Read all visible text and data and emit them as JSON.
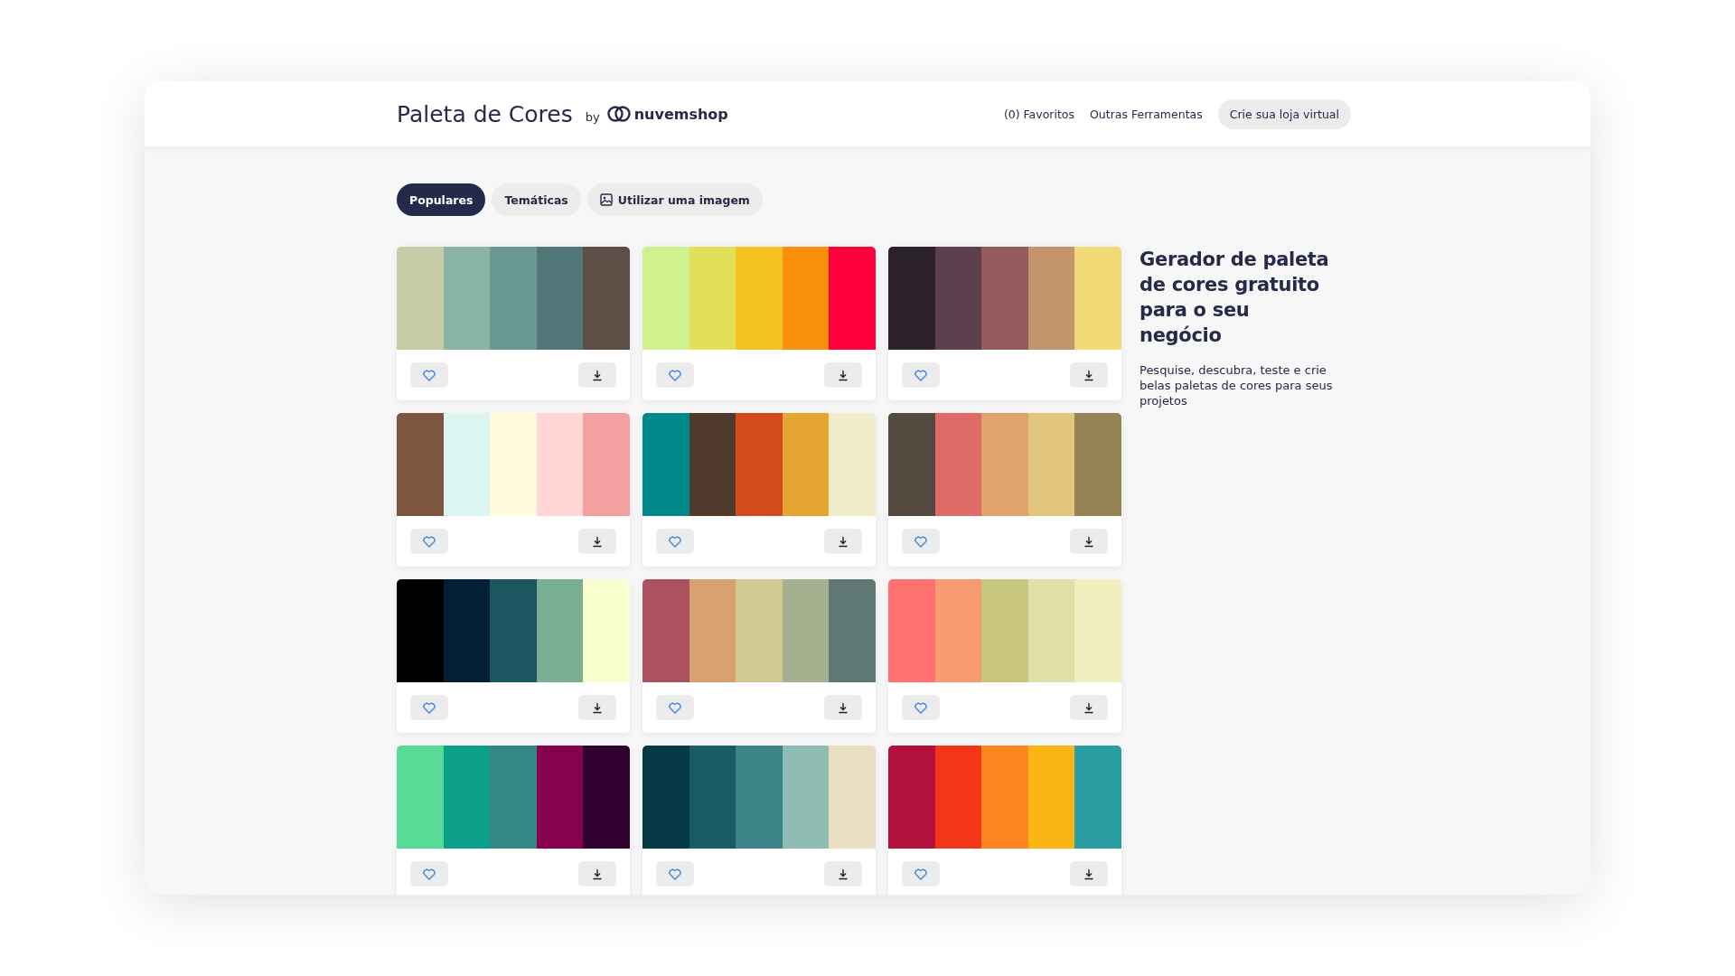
{
  "header": {
    "title": "Paleta de Cores",
    "by": "by",
    "brand": "nuvemshop",
    "nav": [
      "(0) Favoritos",
      "Outras Ferramentas"
    ],
    "cta": "Crie sua loja virtual"
  },
  "tabs": [
    {
      "label": "Populares",
      "selected": true,
      "kind": "text"
    },
    {
      "label": "Temáticas",
      "selected": false,
      "kind": "text"
    },
    {
      "label": "Utilizar uma imagem",
      "selected": false,
      "kind": "image"
    }
  ],
  "palettes": [
    {
      "swatches": [
        {
          "color": "#c6cca5"
        },
        {
          "color": "#8ab5a4"
        },
        {
          "color": "#6a9895"
        },
        {
          "color": "#527779"
        },
        {
          "color": "#5e4e45"
        }
      ]
    },
    {
      "swatches": [
        {
          "color": "#cff28f"
        },
        {
          "color": "#e2e05a"
        },
        {
          "color": "#f5c320"
        },
        {
          "color": "#fa8f0c"
        },
        {
          "color": "#ff003c"
        }
      ]
    },
    {
      "swatches": [
        {
          "color": "#2b222c"
        },
        {
          "color": "#5e3f4d"
        },
        {
          "color": "#965c5d"
        },
        {
          "color": "#c4956c"
        },
        {
          "color": "#f1d976"
        }
      ]
    },
    {
      "swatches": [
        {
          "color": "#7e5640"
        },
        {
          "color": "#dcf5f0"
        },
        {
          "color": "#fefcdb"
        },
        {
          "color": "#ffd6d6"
        },
        {
          "color": "#f4a0a0"
        }
      ]
    },
    {
      "swatches": [
        {
          "color": "#00898a"
        },
        {
          "color": "#4f3a2c"
        },
        {
          "color": "#d24b1a"
        },
        {
          "color": "#e4a630"
        },
        {
          "color": "#f0ebc8"
        }
      ]
    },
    {
      "swatches": [
        {
          "color": "#554a40"
        },
        {
          "color": "#e06a67"
        },
        {
          "color": "#e0a36b"
        },
        {
          "color": "#e2c67e"
        },
        {
          "color": "#948353"
        }
      ]
    },
    {
      "swatches": [
        {
          "color": "#000000"
        },
        {
          "color": "#011f35"
        },
        {
          "color": "#1c5761"
        },
        {
          "color": "#79ae90"
        },
        {
          "color": "#f8fecd"
        }
      ]
    },
    {
      "swatches": [
        {
          "color": "#ac515f"
        },
        {
          "color": "#d9a070"
        },
        {
          "color": "#d1c992"
        },
        {
          "color": "#a5b08e"
        },
        {
          "color": "#5f7874"
        }
      ]
    },
    {
      "swatches": [
        {
          "color": "#ff7071"
        },
        {
          "color": "#f89a72"
        },
        {
          "color": "#c8c67e"
        },
        {
          "color": "#e1e0a8"
        },
        {
          "color": "#f1efc0"
        }
      ]
    },
    {
      "swatches": [
        {
          "color": "#57db96"
        },
        {
          "color": "#0c9f8a"
        },
        {
          "color": "#358784"
        },
        {
          "color": "#880050"
        },
        {
          "color": "#30002f"
        }
      ]
    },
    {
      "swatches": [
        {
          "color": "#053945"
        },
        {
          "color": "#1a5c63"
        },
        {
          "color": "#3d8488"
        },
        {
          "color": "#8fbcb3"
        },
        {
          "color": "#ebdfc3"
        }
      ]
    },
    {
      "swatches": [
        {
          "color": "#b1113a"
        },
        {
          "color": "#f33617"
        },
        {
          "color": "#fd8521"
        },
        {
          "color": "#fcb613"
        },
        {
          "color": "#2b9ea4"
        }
      ]
    }
  ],
  "aside": {
    "heading": "Gerador de paleta de cores gratuito para o seu negócio",
    "text": "Pesquise, descubra, teste e crie belas paletas de cores para seus projetos"
  }
}
